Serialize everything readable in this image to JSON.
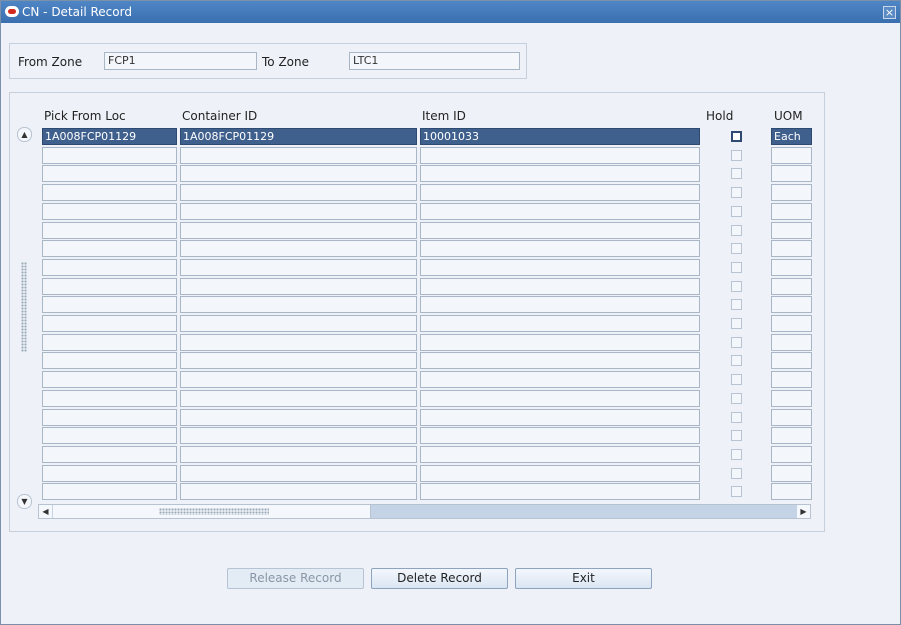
{
  "window": {
    "title": "CN - Detail Record"
  },
  "zone": {
    "from_label": "From Zone",
    "from_value": "FCP1",
    "to_label": "To Zone",
    "to_value": "LTC1"
  },
  "grid": {
    "headers": {
      "pick_from_loc": "Pick From Loc",
      "container_id": "Container ID",
      "item_id": "Item ID",
      "hold": "Hold",
      "uom": "UOM"
    },
    "rows": [
      {
        "pick_from_loc": "1A008FCP01129",
        "container_id": "1A008FCP01129",
        "item_id": "10001033",
        "hold": false,
        "uom": "Each",
        "selected": true
      }
    ],
    "total_rows": 20
  },
  "buttons": {
    "release": "Release Record",
    "delete": "Delete Record",
    "exit": "Exit"
  }
}
